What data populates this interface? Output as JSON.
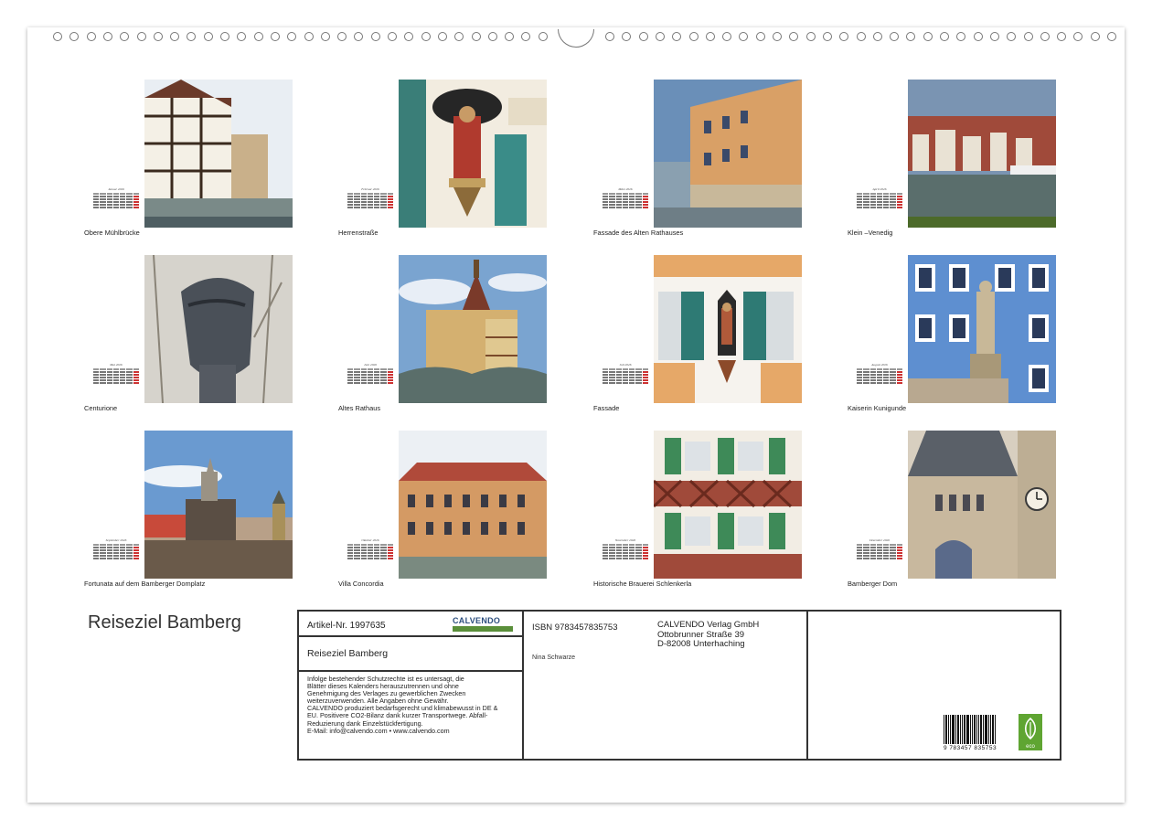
{
  "calendar": {
    "title": "Reiseziel Bamberg",
    "months": [
      {
        "month_label": "Januar 2026",
        "caption": "Obere Mühlbrücke",
        "image_icon": "timber-frame-house-photo"
      },
      {
        "month_label": "Februar 2026",
        "caption": "Herrenstraße",
        "image_icon": "saint-statue-facade-photo"
      },
      {
        "month_label": "März 2026",
        "caption": "Fassade des Alten Rathauses",
        "image_icon": "painted-facade-photo"
      },
      {
        "month_label": "April 2026",
        "caption": "Klein –Venedig",
        "image_icon": "riverside-houses-photo"
      },
      {
        "month_label": "Mai 2026",
        "caption": "Centurione",
        "image_icon": "bronze-head-sculpture-photo"
      },
      {
        "month_label": "Juni 2026",
        "caption": "Altes Rathaus",
        "image_icon": "old-town-hall-photo"
      },
      {
        "month_label": "Juli 2026",
        "caption": "Fassade",
        "image_icon": "madonna-niche-photo"
      },
      {
        "month_label": "August 2026",
        "caption": "Kaiserin Kunigunde",
        "image_icon": "blue-facade-statue-photo"
      },
      {
        "month_label": "September 2026",
        "caption": "Fortunata auf dem Bamberger Domplatz",
        "image_icon": "fortunata-statue-photo"
      },
      {
        "month_label": "Oktober 2026",
        "caption": "Villa Concordia",
        "image_icon": "villa-photo"
      },
      {
        "month_label": "November 2026",
        "caption": "Historische Brauerei Schlenkerla",
        "image_icon": "brewery-facade-photo"
      },
      {
        "month_label": "Dezember 2026",
        "caption": "Bamberger Dom",
        "image_icon": "cathedral-photo"
      }
    ]
  },
  "info_box": {
    "article": "Artikel-Nr. 1997635",
    "logo": "CALVENDO",
    "subtitle": "Reiseziel Bamberg",
    "legal_lines": [
      "Infolge bestehender Schutzrechte ist es untersagt, die",
      "Blätter dieses Kalenders herauszutrennen und ohne",
      "Genehmigung des Verlages zu gewerblichen Zwecken",
      "weiterzuverwenden. Alle Angaben ohne Gewähr.",
      "CALVENDO produziert bedarfsgerecht und klimabewusst in DE &",
      "EU. Positivere CO2-Bilanz dank kurzer Transportwege. Abfall-",
      "Reduzierung dank Einzelstückfertigung.",
      "E-Mail: info@calvendo.com • www.calvendo.com"
    ],
    "isbn": "ISBN 9783457835753",
    "author": "Nina Schwarze",
    "publisher": [
      "CALVENDO Verlag GmbH",
      "Ottobrunner Straße 39",
      "D-82008 Unterhaching"
    ],
    "barcode_number": "9 783457 835753",
    "eco_label": "eco"
  }
}
